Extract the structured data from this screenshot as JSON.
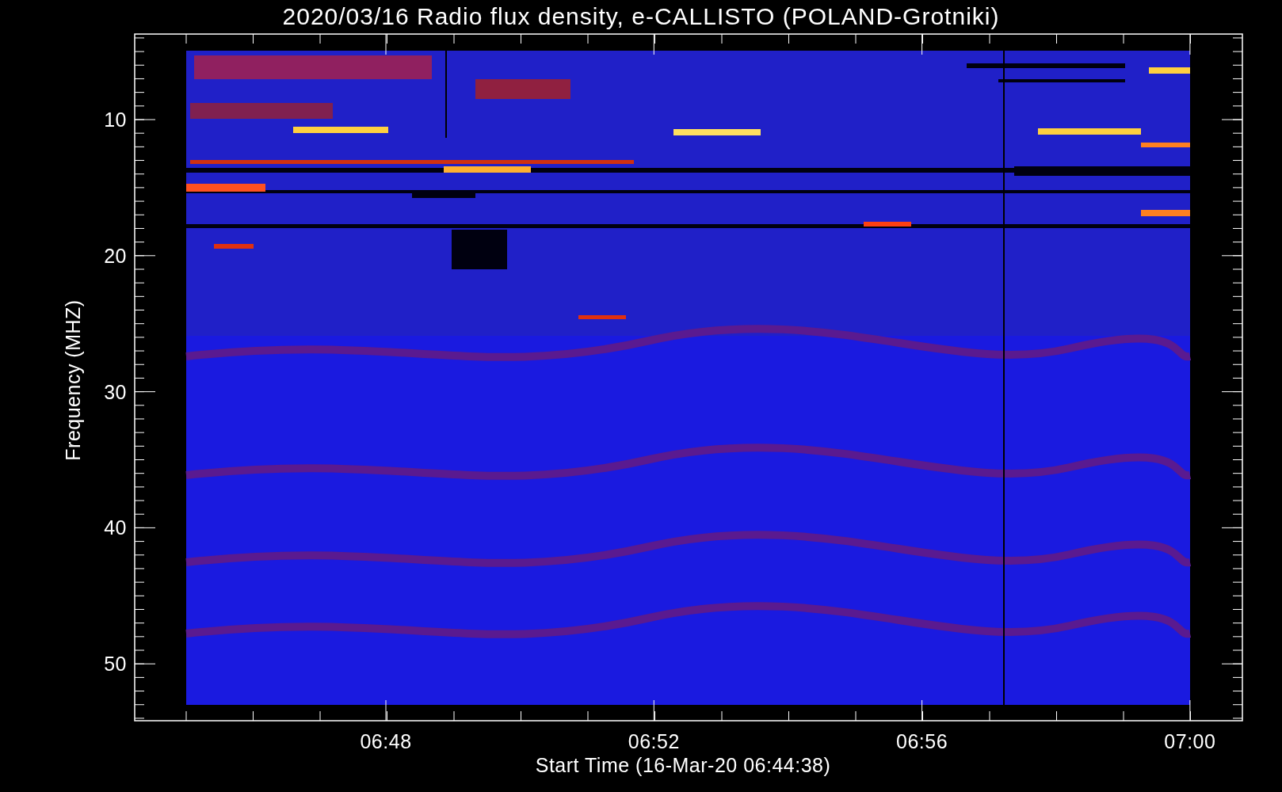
{
  "title": "2020/03/16  Radio flux density, e-CALLISTO (POLAND-Grotniki)",
  "x_axis": {
    "label": "Start Time (16-Mar-20 06:44:38)",
    "ticks": [
      "06:48",
      "06:52",
      "06:56",
      "07:00"
    ]
  },
  "y_axis": {
    "label": "Frequency (MHZ)",
    "ticks": [
      "10",
      "20",
      "30",
      "40",
      "50"
    ]
  }
}
